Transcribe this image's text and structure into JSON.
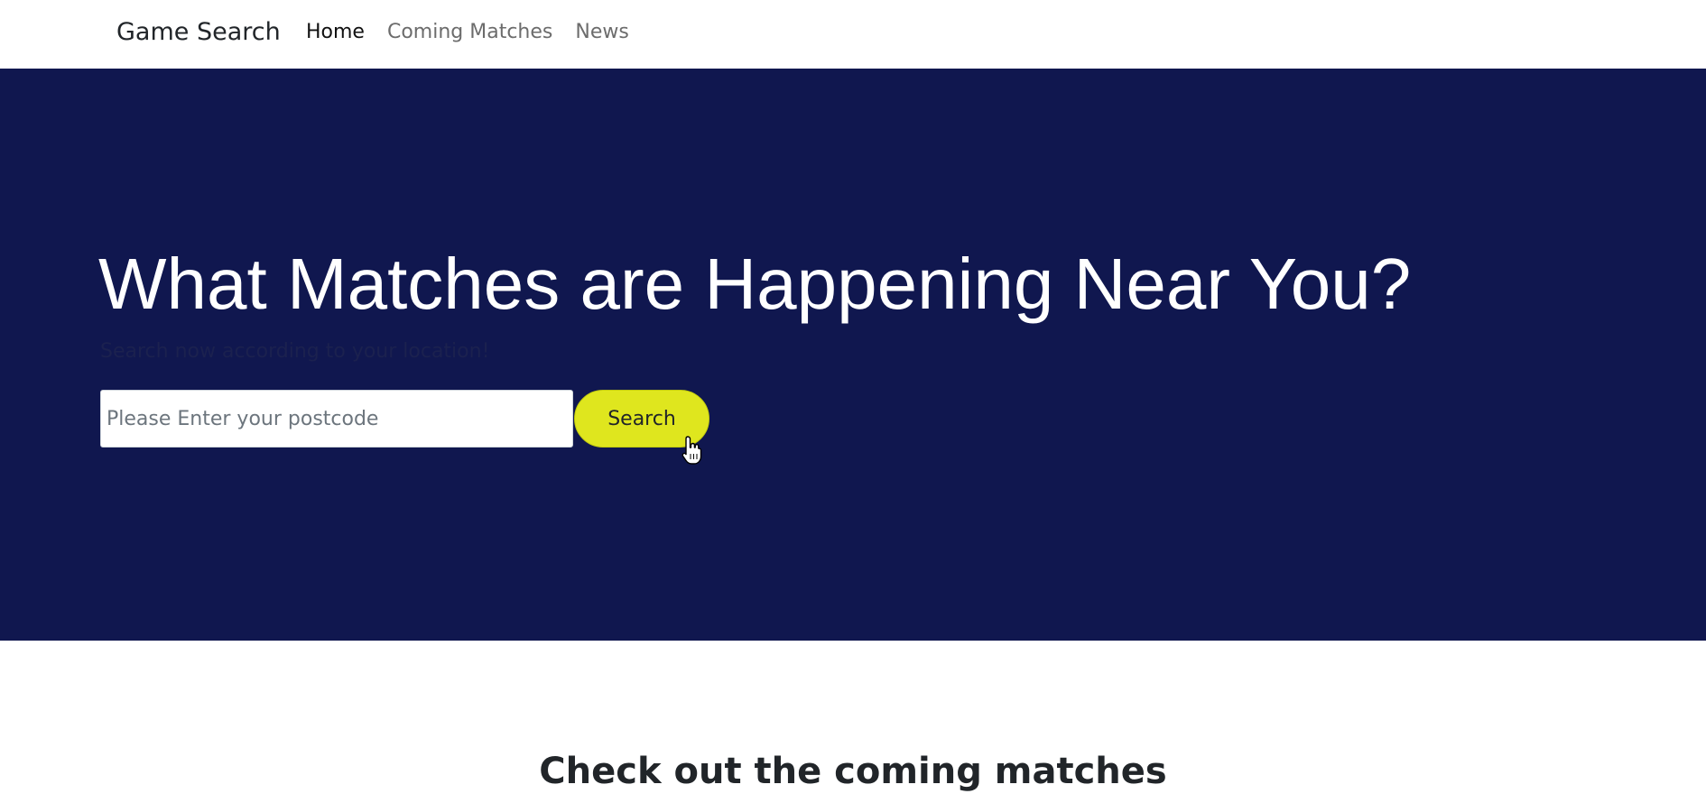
{
  "navbar": {
    "brand": "Game Search",
    "links": [
      {
        "label": "Home",
        "active": true
      },
      {
        "label": "Coming Matches",
        "active": false
      },
      {
        "label": "News",
        "active": false
      }
    ]
  },
  "hero": {
    "title": "What Matches are Happening Near You?",
    "subtitle": "Search now according to your location!",
    "search": {
      "placeholder": "Please Enter your postcode",
      "value": "",
      "button_label": "Search"
    }
  },
  "coming_section": {
    "title": "Check out the coming matches"
  },
  "colors": {
    "hero_bg": "#10174f",
    "accent": "#dfe61e",
    "text_dark": "#212529"
  },
  "icons": {
    "cursor": "hand-pointer-icon"
  }
}
